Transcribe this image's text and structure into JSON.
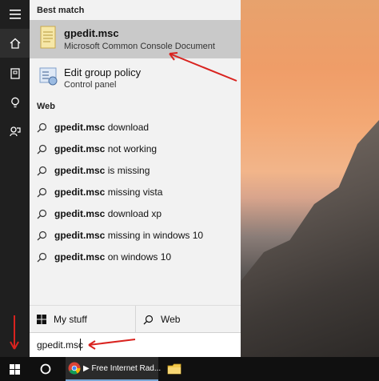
{
  "search": {
    "best_match_title": "Best match",
    "best_match": {
      "title": "gpedit.msc",
      "subtitle": "Microsoft Common Console Document"
    },
    "second_match": {
      "title": "Edit group policy",
      "subtitle": "Control panel"
    },
    "web_title": "Web",
    "web_suggestions": [
      {
        "bold": "gpedit.msc",
        "rest": " download"
      },
      {
        "bold": "gpedit.msc",
        "rest": " not working"
      },
      {
        "bold": "gpedit.msc",
        "rest": " is missing"
      },
      {
        "bold": "gpedit.msc",
        "rest": " missing vista"
      },
      {
        "bold": "gpedit.msc",
        "rest": " download xp"
      },
      {
        "bold": "gpedit.msc",
        "rest": " missing in windows 10"
      },
      {
        "bold": "gpedit.msc",
        "rest": " on windows 10"
      }
    ],
    "tabs": {
      "my_stuff": "My stuff",
      "web": "Web"
    },
    "query": "gpedit.msc"
  },
  "rail": {
    "icons": [
      "hamburger-icon",
      "home-icon",
      "notebook-icon",
      "lightbulb-icon",
      "feedback-icon"
    ]
  },
  "taskbar": {
    "start_icon": "windows-logo-icon",
    "cortana_icon": "cortana-circle-icon",
    "chrome_label": "▶ Free Internet Rad...",
    "folder_icon": "file-explorer-icon"
  },
  "colors": {
    "accent_red": "#d9231f",
    "panel_bg": "#f2f2f2",
    "rail_bg": "#1f1f1f",
    "taskbar_bg": "#101010"
  }
}
